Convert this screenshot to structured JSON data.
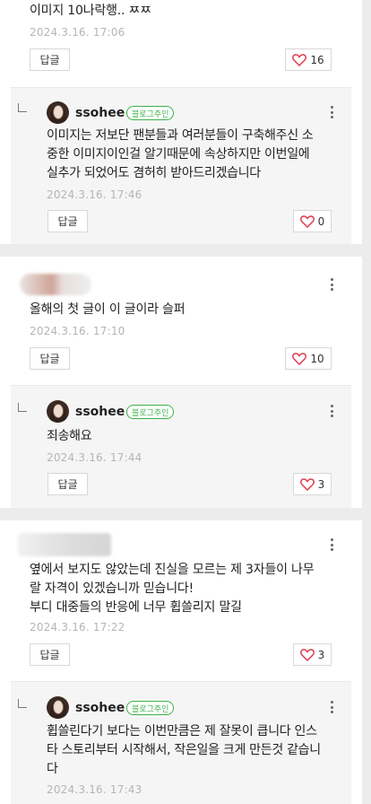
{
  "comments": [
    {
      "text": "이미지 10나락행.. ㅉㅉ",
      "date": "2024.3.16. 17:06",
      "reply_label": "답글",
      "likes": "16",
      "reply": {
        "nick": "ssohee",
        "badge": "블로그주인",
        "lines": [
          "이미지는 저보단 팬분들과 여러분들이 구축해주신 소",
          "중한 이미지이인걸 알기때문에 속상하지만 이번일에",
          "실추가 되었어도 겸허히 받아드리겠습니다"
        ],
        "date": "2024.3.16. 17:46",
        "reply_label": "답글",
        "likes": "0"
      }
    },
    {
      "text": "올해의 첫 글이 이 글이라 슬퍼",
      "date": "2024.3.16. 17:10",
      "reply_label": "답글",
      "likes": "10",
      "reply": {
        "nick": "ssohee",
        "badge": "블로그주인",
        "lines": [
          "죄송해요"
        ],
        "date": "2024.3.16. 17:44",
        "reply_label": "답글",
        "likes": "3"
      }
    },
    {
      "lines": [
        "옆에서 보지도 않았는데 진실을 모르는 제 3자들이 나무",
        "랄 자격이 있겠습니까 믿습니다!",
        "부디 대중들의 반응에 너무 휩쓸리지 말길"
      ],
      "date": "2024.3.16. 17:22",
      "reply_label": "답글",
      "likes": "3",
      "reply": {
        "nick": "ssohee",
        "badge": "블로그주인",
        "lines": [
          "휩쓸린다기 보다는 이번만큼은 제 잘못이 큽니다 인스",
          "타 스토리부터 시작해서, 작은일을 크게 만든것 같습니",
          "다"
        ],
        "date": "2024.3.16. 17:43"
      }
    }
  ],
  "colors": {
    "badge_green": "#3cb24a",
    "heart_red": "#e03a4e",
    "date_gray": "#b5b5b5"
  },
  "icons": {
    "like": "heart-icon",
    "menu": "more-vertical-icon",
    "reply_marker": "reply-arrow-icon"
  }
}
